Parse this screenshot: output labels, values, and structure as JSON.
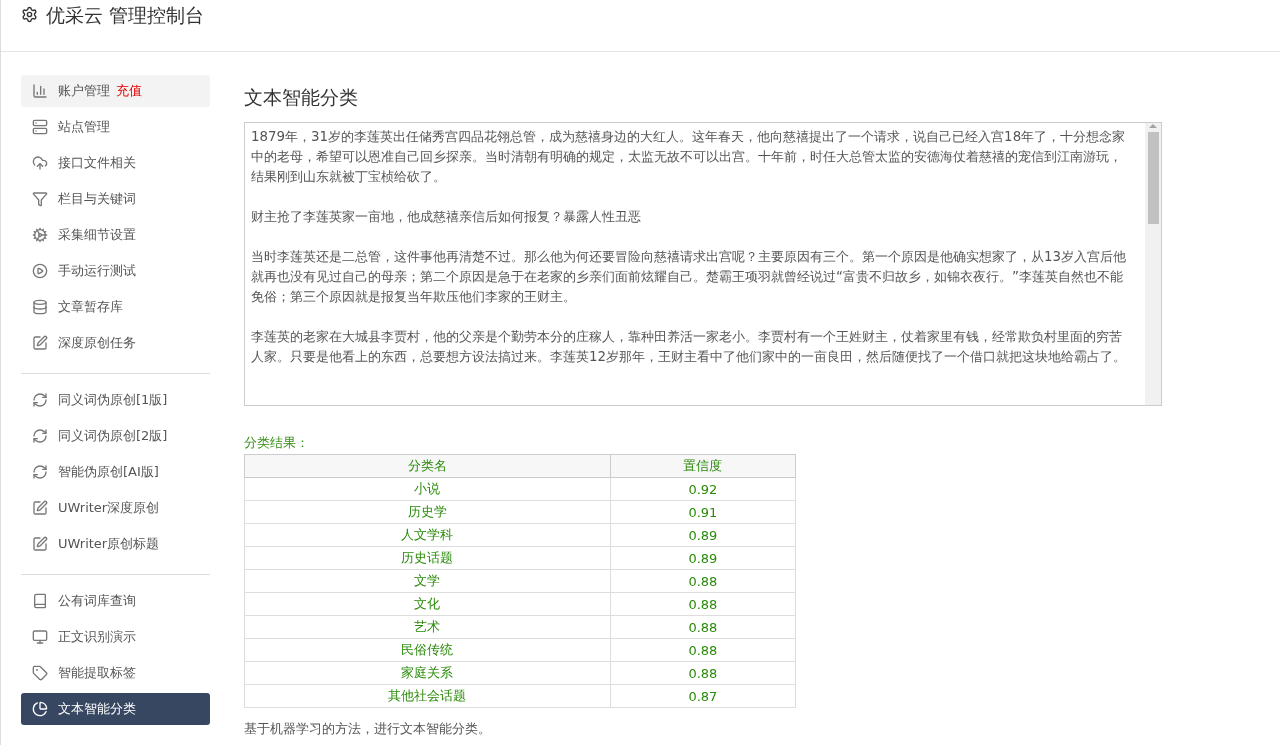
{
  "header": {
    "title": "优采云 管理控制台"
  },
  "sidebar": {
    "groups": [
      {
        "items": [
          {
            "kind": "chart",
            "label": "账户管理",
            "badge": "充值",
            "selected": false,
            "hovered": true
          },
          {
            "kind": "server",
            "label": "站点管理",
            "selected": false,
            "hovered": false
          },
          {
            "kind": "cloud",
            "label": "接口文件相关",
            "selected": false,
            "hovered": false
          },
          {
            "kind": "filter",
            "label": "栏目与关键词",
            "selected": false,
            "hovered": false
          },
          {
            "kind": "gears",
            "label": "采集细节设置",
            "selected": false,
            "hovered": false
          },
          {
            "kind": "play",
            "label": "手动运行测试",
            "selected": false,
            "hovered": false
          },
          {
            "kind": "database",
            "label": "文章暂存库",
            "selected": false,
            "hovered": false
          },
          {
            "kind": "edit",
            "label": "深度原创任务",
            "selected": false,
            "hovered": false
          }
        ]
      },
      {
        "items": [
          {
            "kind": "refresh",
            "label": "同义词伪原创[1版]",
            "selected": false,
            "hovered": false
          },
          {
            "kind": "refresh",
            "label": "同义词伪原创[2版]",
            "selected": false,
            "hovered": false
          },
          {
            "kind": "refresh",
            "label": "智能伪原创[AI版]",
            "selected": false,
            "hovered": false
          },
          {
            "kind": "edit",
            "label": "UWriter深度原创",
            "selected": false,
            "hovered": false
          },
          {
            "kind": "edit",
            "label": "UWriter原创标题",
            "selected": false,
            "hovered": false
          }
        ]
      },
      {
        "items": [
          {
            "kind": "book",
            "label": "公有词库查询",
            "selected": false,
            "hovered": false
          },
          {
            "kind": "monitor",
            "label": "正文识别演示",
            "selected": false,
            "hovered": false
          },
          {
            "kind": "tag",
            "label": "智能提取标签",
            "selected": false,
            "hovered": false
          },
          {
            "kind": "pie",
            "label": "文本智能分类",
            "selected": true,
            "hovered": false
          }
        ]
      }
    ]
  },
  "main": {
    "title": "文本智能分类",
    "article": [
      "1879年，31岁的李莲英出任储秀宫四品花翎总管，成为慈禧身边的大红人。这年春天，他向慈禧提出了一个请求，说自己已经入宫18年了，十分想念家中的老母，希望可以恩准自己回乡探亲。当时清朝有明确的规定，太监无故不可以出宫。十年前，时任大总管太监的安德海仗着慈禧的宠信到江南游玩，结果刚到山东就被丁宝桢给砍了。",
      "财主抢了李莲英家一亩地，他成慈禧亲信后如何报复？暴露人性丑恶",
      "当时李莲英还是二总管，这件事他再清楚不过。那么他为何还要冒险向慈禧请求出宫呢？主要原因有三个。第一个原因是他确实想家了，从13岁入宫后他就再也没有见过自己的母亲；第二个原因是急于在老家的乡亲们面前炫耀自己。楚霸王项羽就曾经说过“富贵不归故乡，如锦衣夜行。”李莲英自然也不能免俗；第三个原因就是报复当年欺压他们李家的王财主。",
      "李莲英的老家在大城县李贾村，他的父亲是个勤劳本分的庄稼人，靠种田养活一家老小。李贾村有一个王姓财主，仗着家里有钱，经常欺负村里面的穷苦人家。只要是他看上的东西，总要想方设法搞过来。李莲英12岁那年，王财主看中了他们家中的一亩良田，然后随便找了一个借口就把这块地给霸占了。"
    ],
    "result_label": "分类结果：",
    "table": {
      "columns": [
        "分类名",
        "置信度"
      ],
      "rows": [
        [
          "小说",
          "0.92"
        ],
        [
          "历史学",
          "0.91"
        ],
        [
          "人文学科",
          "0.89"
        ],
        [
          "历史话题",
          "0.89"
        ],
        [
          "文学",
          "0.88"
        ],
        [
          "文化",
          "0.88"
        ],
        [
          "艺术",
          "0.88"
        ],
        [
          "民俗传统",
          "0.88"
        ],
        [
          "家庭关系",
          "0.88"
        ],
        [
          "其他社会话题",
          "0.87"
        ]
      ]
    },
    "note": "基于机器学习的方法，进行文本智能分类。"
  }
}
